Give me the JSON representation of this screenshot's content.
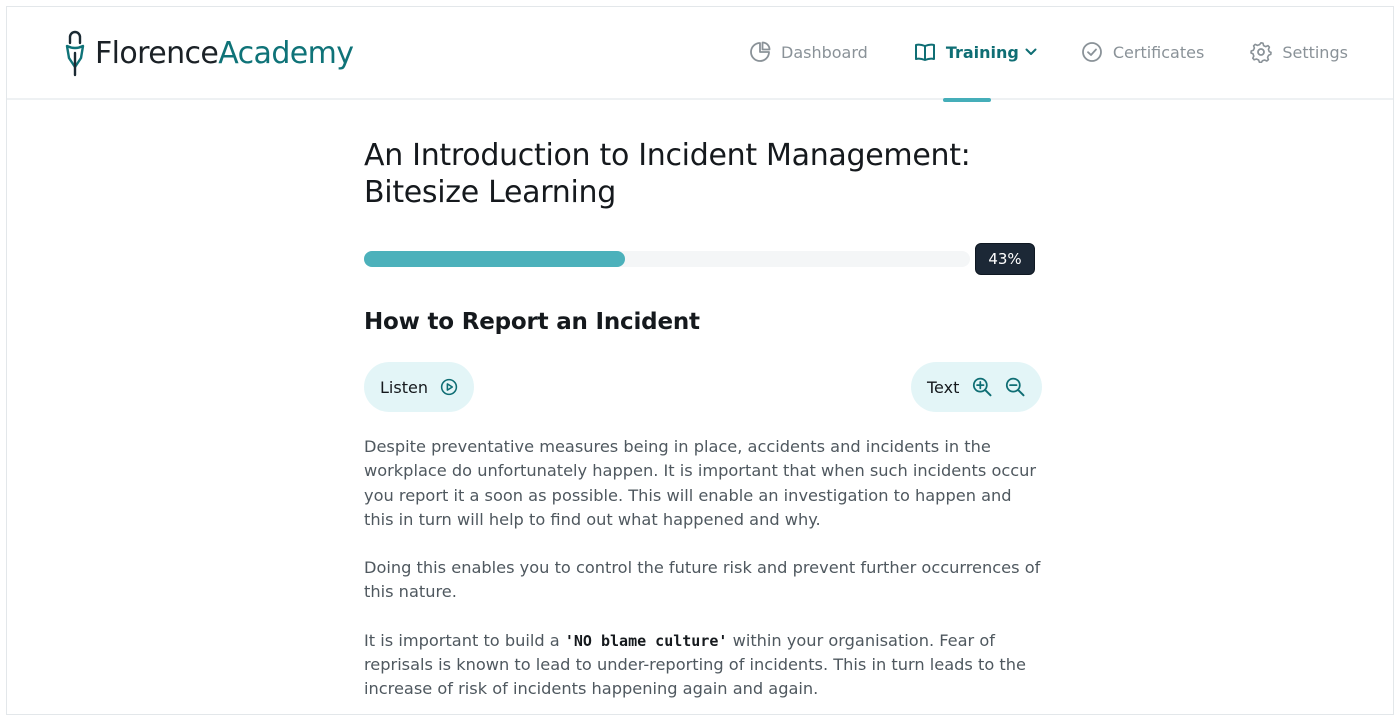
{
  "brand": {
    "name_part1": "Florence",
    "name_part2": "Academy",
    "colors": {
      "accent": "#0f7378",
      "progress": "#4cb1bb",
      "pill_bg": "#e3f5f7",
      "badge_bg": "#1c2836"
    }
  },
  "nav": {
    "items": [
      {
        "label": "Dashboard",
        "icon": "pie-chart-icon",
        "active": false
      },
      {
        "label": "Training",
        "icon": "book-icon",
        "active": true,
        "has_dropdown": true
      },
      {
        "label": "Certificates",
        "icon": "check-circle-icon",
        "active": false
      },
      {
        "label": "Settings",
        "icon": "gear-icon",
        "active": false
      }
    ]
  },
  "course": {
    "title_line1": "An Introduction to Incident Management:",
    "title_line2": "Bitesize Learning",
    "progress_percent": 43,
    "progress_label": "43%"
  },
  "lesson": {
    "section_title": "How to Report an Incident",
    "listen_label": "Listen",
    "text_label": "Text",
    "paragraphs": [
      {
        "text": "Despite preventative measures being in place, accidents and incidents in the workplace do unfortunately happen. It is important that when such incidents occur you report it a soon as possible. This will enable an investigation to happen and this in turn will help to find out what happened and why."
      },
      {
        "text": "Doing this enables you to control the future risk and prevent further occurrences of this nature."
      },
      {
        "before": "It is important to build a ",
        "bold": "'NO blame culture'",
        "after": " within your organisation. Fear of reprisals is known to lead to under-reporting of incidents. This in turn leads to the increase of risk of incidents happening again and again."
      }
    ]
  }
}
